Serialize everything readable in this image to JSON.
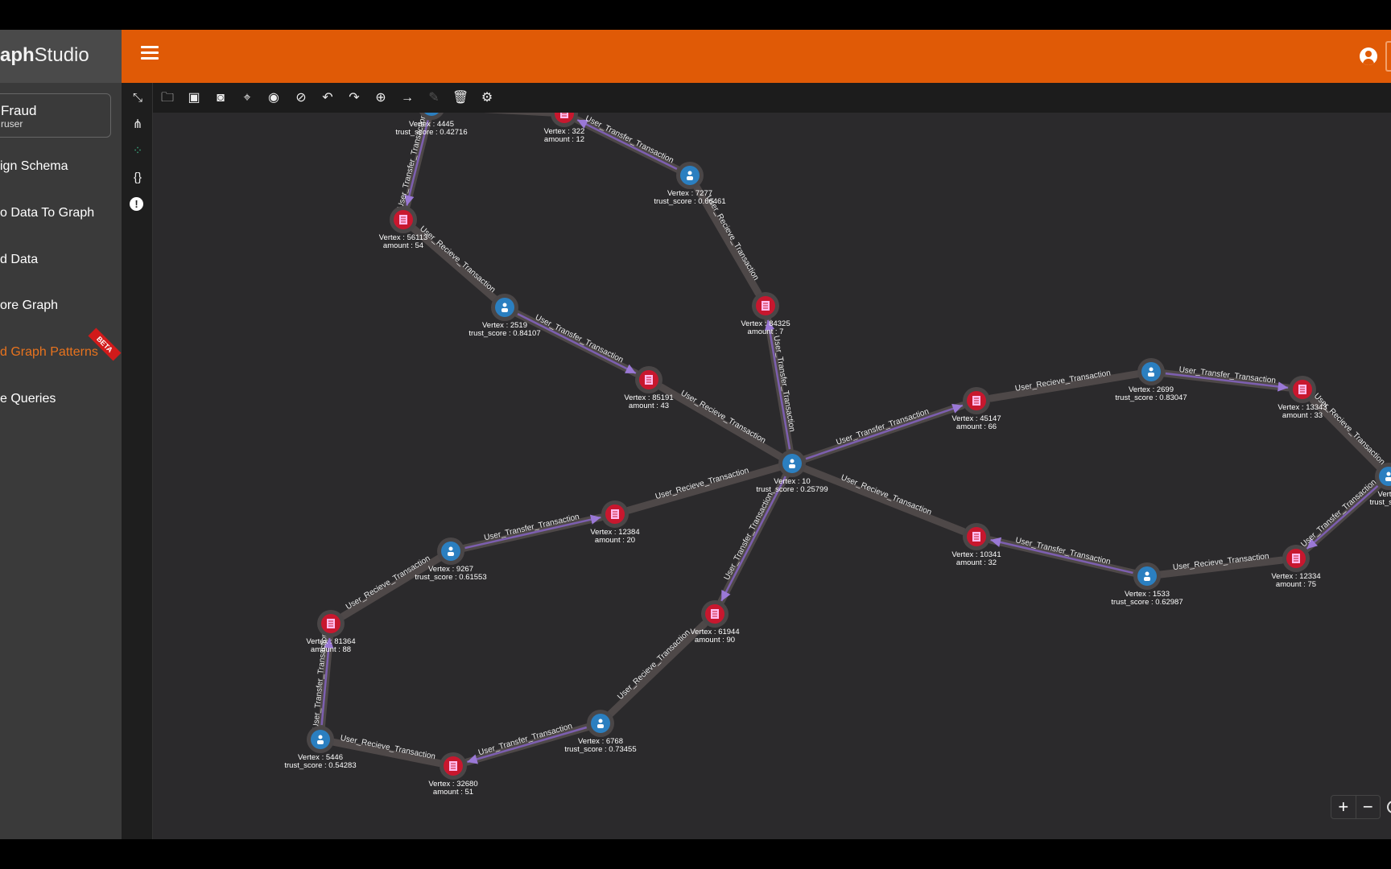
{
  "app": {
    "logo_plain": "aph",
    "logo_rest": "Studio"
  },
  "header": {
    "menu_icon": "hamburger-icon",
    "user_icon": "account-circle-icon"
  },
  "sidebar": {
    "project": {
      "name": "Fraud",
      "user": "ruser"
    },
    "items": [
      {
        "label": "ign Schema"
      },
      {
        "label": "o Data To Graph"
      },
      {
        "label": "d Data"
      },
      {
        "label": "ore Graph"
      },
      {
        "label": "d Graph Patterns",
        "active": true,
        "badge": "BETA"
      },
      {
        "label": "e Queries"
      }
    ]
  },
  "colors": {
    "accent": "#e05a06",
    "user_vertex": "#2b7fc0",
    "transaction_vertex": "#c8172e",
    "transfer_edge": "#7d5fb0",
    "recieve_edge": "#5b5350"
  },
  "icon_column": [
    "shrink-icon",
    "schema-tree-icon",
    "layout-dots-icon",
    "json-braces-icon",
    "alert-icon"
  ],
  "toolbar": [
    "open-folder-icon",
    "save-icon",
    "screenshot-icon",
    "locate-icon",
    "show-icon",
    "hide-icon",
    "undo-icon",
    "redo-icon",
    "add-vertex-icon",
    "add-edge-icon",
    "edit-icon",
    "delete-icon",
    "settings-icon"
  ],
  "zoom": {
    "plus": "+",
    "minus": "−"
  },
  "graph": {
    "nodes": [
      {
        "id": "4445",
        "type": "user",
        "attr": "trust_score : 0.42716"
      },
      {
        "id": "322",
        "type": "txn",
        "attr": "amount : 12"
      },
      {
        "id": "7277",
        "type": "user",
        "attr": "trust_score : 0.66461"
      },
      {
        "id": "56113",
        "type": "txn",
        "attr": "amount : 54"
      },
      {
        "id": "2519",
        "type": "user",
        "attr": "trust_score : 0.84107"
      },
      {
        "id": "84325",
        "type": "txn",
        "attr": "amount : 7"
      },
      {
        "id": "85191",
        "type": "txn",
        "attr": "amount : 43"
      },
      {
        "id": "10",
        "type": "user",
        "attr": "trust_score : 0.25799"
      },
      {
        "id": "45147",
        "type": "txn",
        "attr": "amount : 66"
      },
      {
        "id": "2699",
        "type": "user",
        "attr": "trust_score : 0.83047"
      },
      {
        "id": "13343",
        "type": "txn",
        "attr": "amount : 33"
      },
      {
        "id": "right",
        "type": "user",
        "label": "Vertex",
        "attr": "trust_score"
      },
      {
        "id": "12334",
        "type": "txn",
        "attr": "amount : 75"
      },
      {
        "id": "1533",
        "type": "user",
        "attr": "trust_score : 0.62987"
      },
      {
        "id": "10341",
        "type": "txn",
        "attr": "amount : 32"
      },
      {
        "id": "12384",
        "type": "txn",
        "attr": "amount : 20"
      },
      {
        "id": "9267",
        "type": "user",
        "attr": "trust_score : 0.61553"
      },
      {
        "id": "81364",
        "type": "txn",
        "attr": "amount : 88"
      },
      {
        "id": "5446",
        "type": "user",
        "attr": "trust_score : 0.54283"
      },
      {
        "id": "32680",
        "type": "txn",
        "attr": "amount : 51"
      },
      {
        "id": "6768",
        "type": "user",
        "attr": "trust_score : 0.73455"
      },
      {
        "id": "61944",
        "type": "txn",
        "attr": "amount : 90"
      }
    ],
    "vertex_prefix": "Vertex : ",
    "edges": [
      {
        "from": "4445",
        "to": "322",
        "label": "User_Recieve_Transaction"
      },
      {
        "from": "4445",
        "to": "56113",
        "label": "User_Transfer_Transaction"
      },
      {
        "from": "7277",
        "to": "322",
        "label": "User_Transfer_Transaction"
      },
      {
        "from": "7277",
        "to": "84325",
        "label": "User_Recieve_Transaction"
      },
      {
        "from": "2519",
        "to": "56113",
        "label": "User_Recieve_Transaction"
      },
      {
        "from": "2519",
        "to": "85191",
        "label": "User_Transfer_Transaction"
      },
      {
        "from": "10",
        "to": "85191",
        "label": "User_Recieve_Transaction"
      },
      {
        "from": "10",
        "to": "84325",
        "label": "User_Transfer_Transaction"
      },
      {
        "from": "10",
        "to": "45147",
        "label": "User_Transfer_Transaction"
      },
      {
        "from": "2699",
        "to": "45147",
        "label": "User_Recieve_Transaction"
      },
      {
        "from": "2699",
        "to": "13343",
        "label": "User_Transfer_Transaction"
      },
      {
        "from": "right",
        "to": "13343",
        "label": "User_Recieve_Transaction"
      },
      {
        "from": "right",
        "to": "12334",
        "label": "User_Transfer_Transaction"
      },
      {
        "from": "1533",
        "to": "12334",
        "label": "User_Recieve_Transaction"
      },
      {
        "from": "1533",
        "to": "10341",
        "label": "User_Transfer_Transaction"
      },
      {
        "from": "10",
        "to": "10341",
        "label": "User_Recieve_Transaction"
      },
      {
        "from": "10",
        "to": "61944",
        "label": "User_Transfer_Transaction"
      },
      {
        "from": "6768",
        "to": "61944",
        "label": "User_Recieve_Transaction"
      },
      {
        "from": "6768",
        "to": "32680",
        "label": "User_Transfer_Transaction"
      },
      {
        "from": "5446",
        "to": "32680",
        "label": "User_Recieve_Transaction"
      },
      {
        "from": "5446",
        "to": "81364",
        "label": "User_Transfer_Transaction"
      },
      {
        "from": "9267",
        "to": "81364",
        "label": "User_Recieve_Transaction"
      },
      {
        "from": "9267",
        "to": "12384",
        "label": "User_Transfer_Transaction"
      },
      {
        "from": "10",
        "to": "12384",
        "label": "User_Recieve_Transaction"
      }
    ]
  }
}
